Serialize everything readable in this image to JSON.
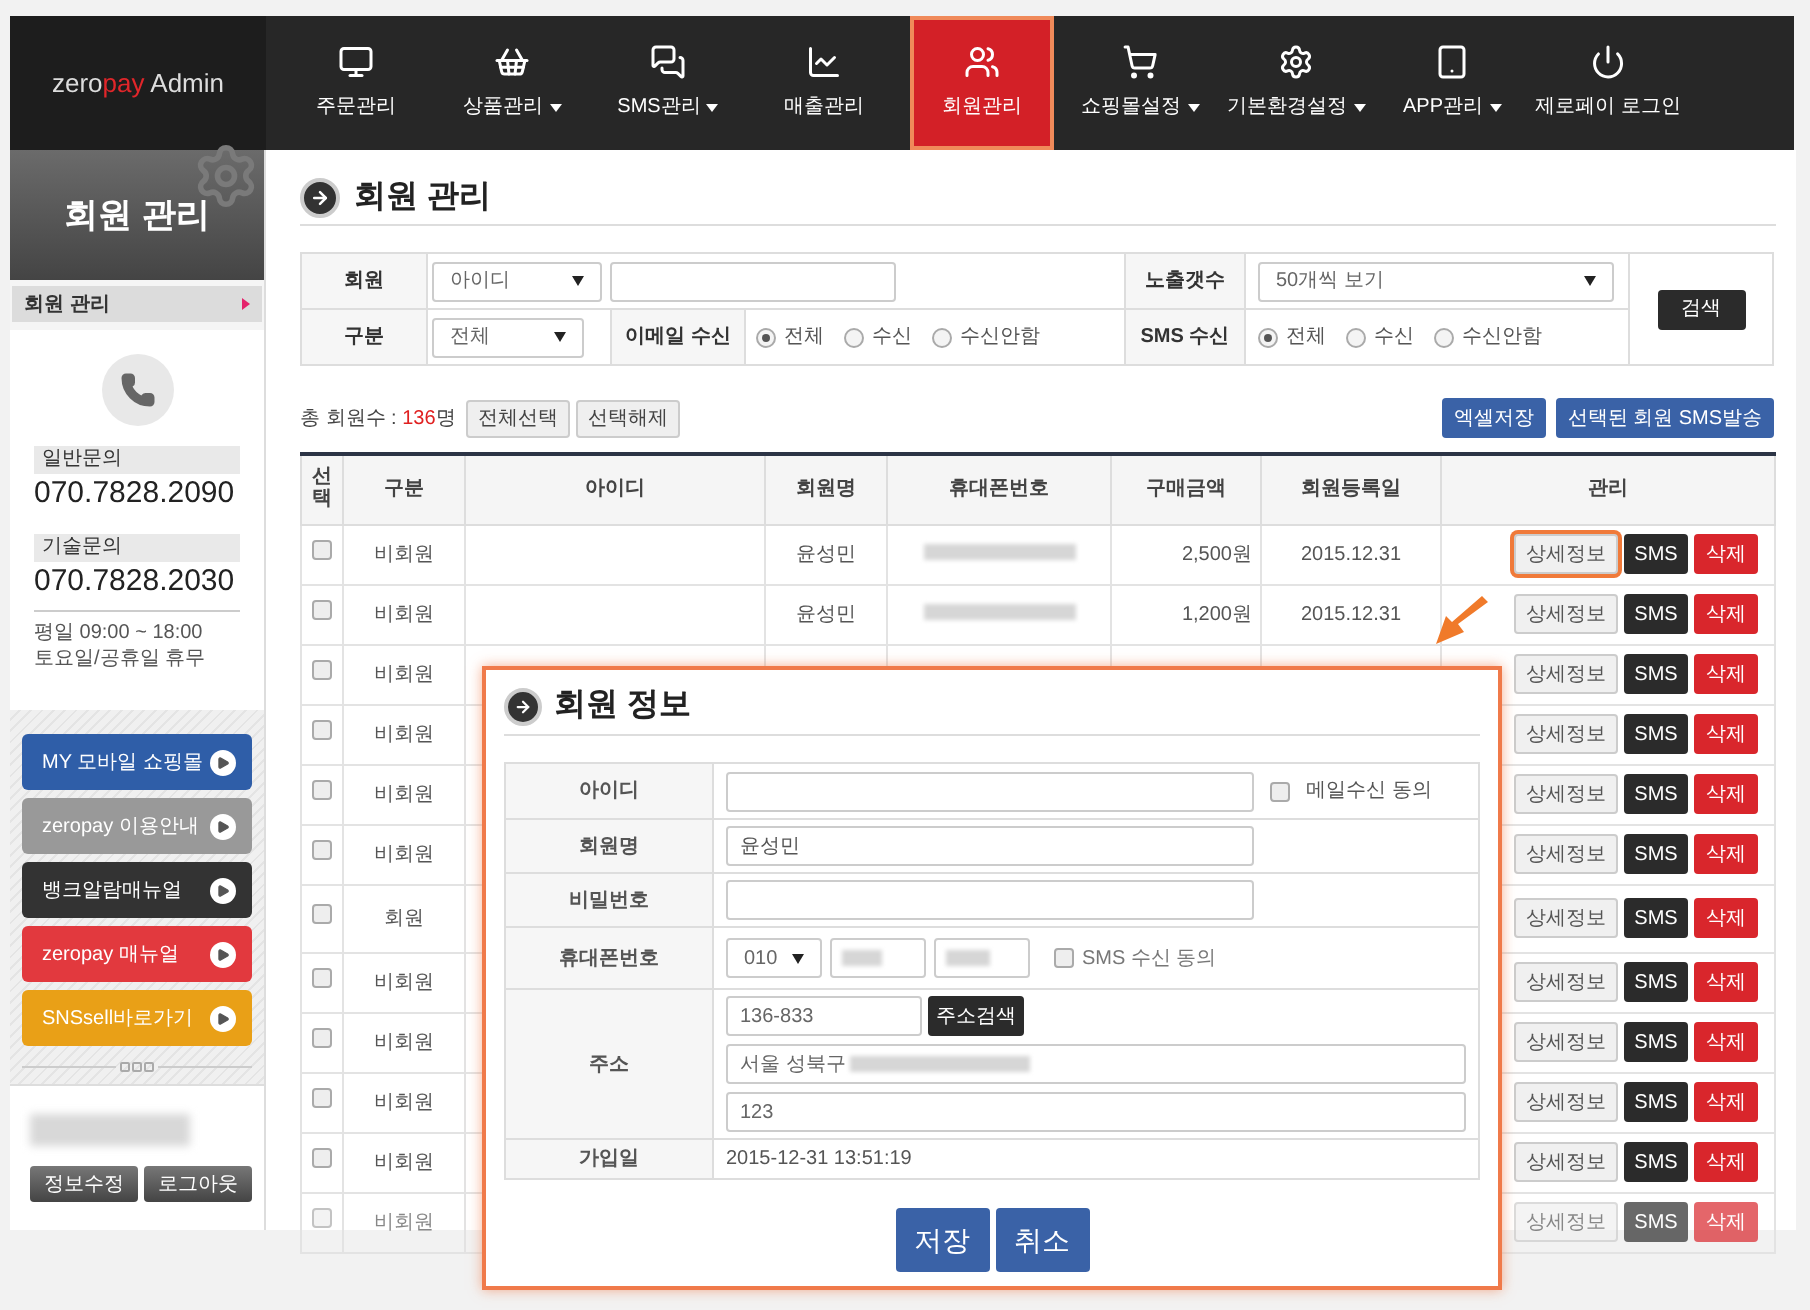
{
  "logo": {
    "prefix": "zero",
    "highlight": "pay",
    "suffix": " Admin"
  },
  "nav": [
    {
      "label": "주문관리",
      "dropdown": false,
      "selected": false
    },
    {
      "label": "상품관리",
      "dropdown": true,
      "selected": false
    },
    {
      "label": "SMS관리",
      "dropdown": true,
      "selected": false
    },
    {
      "label": "매출관리",
      "dropdown": false,
      "selected": false
    },
    {
      "label": "회원관리",
      "dropdown": false,
      "selected": true
    },
    {
      "label": "쇼핑몰설정",
      "dropdown": true,
      "selected": false
    },
    {
      "label": "기본환경설정",
      "dropdown": true,
      "selected": false
    },
    {
      "label": "APP관리",
      "dropdown": true,
      "selected": false
    },
    {
      "label": "제로페이 로그인",
      "dropdown": false,
      "selected": false
    }
  ],
  "sidebar": {
    "title": "회원 관리",
    "menu": [
      {
        "label": "회원 관리",
        "selected": true
      }
    ],
    "contacts": [
      {
        "label": "일반문의",
        "number": "070.7828.2090"
      },
      {
        "label": "기술문의",
        "number": "070.7828.2030"
      }
    ],
    "hours": [
      "평일 09:00 ~ 18:00",
      "토요일/공휴일 휴무"
    ],
    "links": [
      {
        "label": "MY 모바일 쇼핑몰",
        "color": "#2f5ea8"
      },
      {
        "label": "zeropay 이용안내",
        "color": "#999999"
      },
      {
        "label": "뱅크알람매뉴얼",
        "color": "#333333"
      },
      {
        "label": "zeropay 매뉴얼",
        "color": "#e2393e"
      },
      {
        "label": "SNSsell바로가기",
        "color": "#e9a017"
      }
    ],
    "user_buttons": [
      "정보수정",
      "로그아웃"
    ]
  },
  "page_title": "회원 관리",
  "search": {
    "member_label": "회원",
    "member_select": "아이디",
    "count_label": "노출갯수",
    "count_select": "50개씩 보기",
    "search_button": "검색",
    "type_label": "구분",
    "type_select": "전체",
    "email_label": "이메일 수신",
    "email_options": [
      {
        "label": "전체",
        "selected": true
      },
      {
        "label": "수신",
        "selected": false
      },
      {
        "label": "수신안함",
        "selected": false
      }
    ],
    "sms_label": "SMS 수신",
    "sms_options": [
      {
        "label": "전체",
        "selected": true
      },
      {
        "label": "수신",
        "selected": false
      },
      {
        "label": "수신안함",
        "selected": false
      }
    ]
  },
  "toolbar": {
    "total_label": "총 회원수 : ",
    "total_count": "136",
    "total_unit": "명",
    "buttons": [
      "전체선택",
      "선택해제"
    ],
    "right_buttons": [
      "엑셀저장",
      "선택된 회원 SMS발송"
    ]
  },
  "table": {
    "columns": [
      "선택",
      "구분",
      "아이디",
      "회원명",
      "휴대폰번호",
      "구매금액",
      "회원등록일",
      "관리"
    ],
    "rows": [
      {
        "checked": false,
        "type": "비회원",
        "name": "윤성민",
        "phone_blurred": true,
        "amount": "2,500원",
        "date": "2015.12.31",
        "highlighted": true,
        "actions": [
          "상세정보",
          "SMS",
          "삭제"
        ]
      },
      {
        "checked": false,
        "type": "비회원",
        "name": "윤성민",
        "phone_blurred": true,
        "amount": "1,200원",
        "date": "2015.12.31",
        "highlighted": false,
        "actions": [
          "상세정보",
          "SMS",
          "삭제"
        ]
      },
      {
        "checked": false,
        "type": "비회원",
        "highlighted": false,
        "actions": [
          "상세정보",
          "SMS",
          "삭제"
        ]
      },
      {
        "checked": false,
        "type": "비회원",
        "highlighted": false,
        "actions": [
          "상세정보",
          "SMS",
          "삭제"
        ]
      },
      {
        "checked": false,
        "type": "비회원",
        "highlighted": false,
        "actions": [
          "상세정보",
          "SMS",
          "삭제"
        ]
      },
      {
        "checked": false,
        "type": "비회원",
        "highlighted": false,
        "actions": [
          "상세정보",
          "SMS",
          "삭제"
        ]
      },
      {
        "checked": false,
        "type": "회원",
        "highlighted": false,
        "actions": [
          "상세정보",
          "SMS",
          "삭제"
        ]
      },
      {
        "checked": false,
        "type": "비회원",
        "highlighted": false,
        "actions": [
          "상세정보",
          "SMS",
          "삭제"
        ]
      },
      {
        "checked": false,
        "type": "비회원",
        "highlighted": false,
        "actions": [
          "상세정보",
          "SMS",
          "삭제"
        ]
      },
      {
        "checked": false,
        "type": "비회원",
        "highlighted": false,
        "actions": [
          "상세정보",
          "SMS",
          "삭제"
        ]
      },
      {
        "checked": false,
        "type": "비회원",
        "highlighted": false,
        "actions": [
          "상세정보",
          "SMS",
          "삭제"
        ]
      },
      {
        "checked": false,
        "type": "비회원",
        "highlighted": false,
        "actions": [
          "상세정보",
          "SMS",
          "삭제"
        ]
      }
    ]
  },
  "modal": {
    "title": "회원 정보",
    "id_label": "아이디",
    "email_agree": {
      "label": "메일수신 동의",
      "checked": false
    },
    "name_label": "회원명",
    "name_value": "윤성민",
    "password_label": "비밀번호",
    "phone_label": "휴대폰번호",
    "phone_prefix": "010",
    "sms_agree": {
      "label": "SMS 수신 동의",
      "checked": false
    },
    "address_label": "주소",
    "zip": "136-833",
    "zip_button": "주소검색",
    "address1": "서울 성북구",
    "address2": "123",
    "joined_label": "가입일",
    "joined_value": "2015-12-31 13:51:19",
    "buttons": [
      "저장",
      "취소"
    ]
  }
}
